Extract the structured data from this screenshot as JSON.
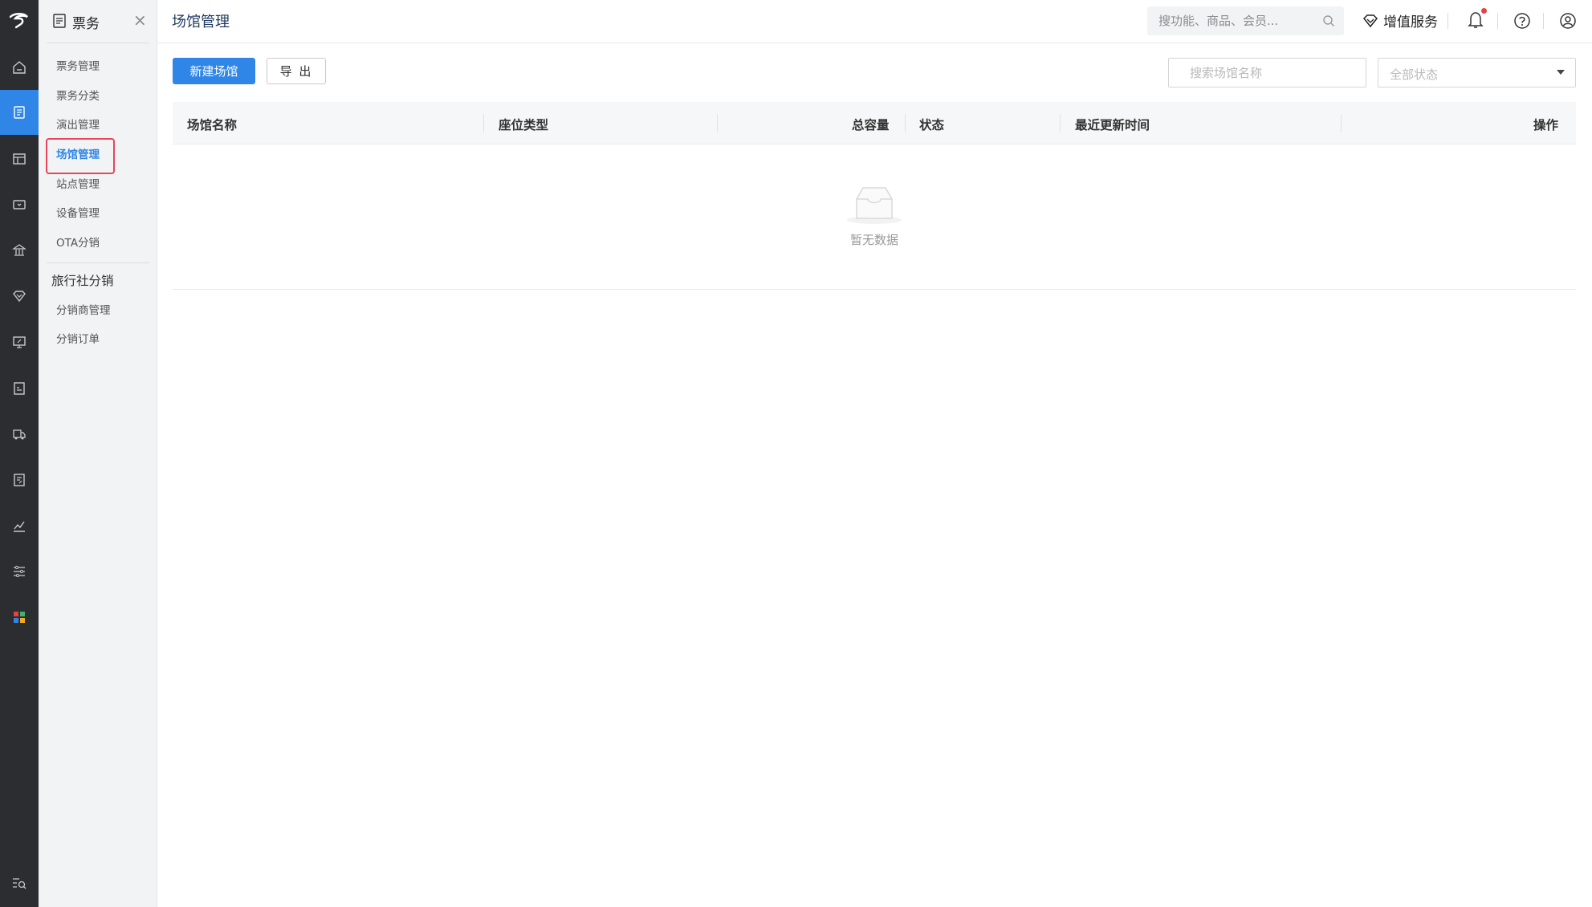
{
  "rail": {
    "logo_icon": "brand-logo-icon",
    "items": [
      {
        "name": "home-icon"
      },
      {
        "name": "ticket-icon",
        "active": true
      },
      {
        "name": "store-icon"
      },
      {
        "name": "camera-icon"
      },
      {
        "name": "bank-icon"
      },
      {
        "name": "heart-shield-icon"
      },
      {
        "name": "screen-percent-icon"
      },
      {
        "name": "id-card-icon"
      },
      {
        "name": "truck-icon"
      },
      {
        "name": "document-icon"
      },
      {
        "name": "chart-icon"
      },
      {
        "name": "sliders-icon"
      },
      {
        "name": "apps-grid-icon"
      }
    ],
    "bottom_icon": "search-list-icon"
  },
  "sidebar": {
    "title": "票务",
    "close": "×",
    "section1": [
      "票务管理",
      "票务分类",
      "演出管理",
      "场馆管理",
      "站点管理",
      "设备管理",
      "OTA分销"
    ],
    "selected": "场馆管理",
    "group2_title": "旅行社分销",
    "section2": [
      "分销商管理",
      "分销订单"
    ]
  },
  "header": {
    "page_title": "场馆管理",
    "search_placeholder": "搜功能、商品、会员...",
    "vip_label": "增值服务"
  },
  "toolbar": {
    "new_label": "新建场馆",
    "export_label": "导 出",
    "filter_placeholder": "搜索场馆名称",
    "status_select": "全部状态"
  },
  "table": {
    "columns": [
      "场馆名称",
      "座位类型",
      "总容量",
      "状态",
      "最近更新时间",
      "操作"
    ],
    "rows": [],
    "empty_text": "暂无数据"
  },
  "colors": {
    "accent": "#2f86e6",
    "rail_bg": "#2b2d30",
    "highlight": "#e8455d",
    "notification": "#e64340"
  }
}
